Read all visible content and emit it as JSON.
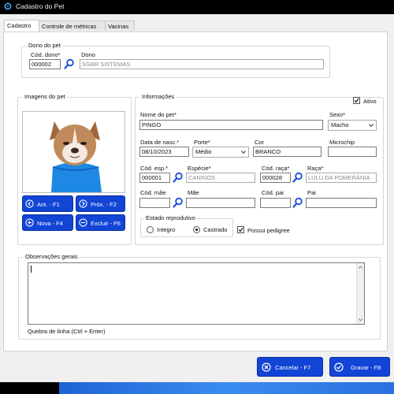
{
  "window": {
    "title": "Cadastro do Pet"
  },
  "tabs": [
    {
      "label": "Cadastro"
    },
    {
      "label": "Controle de métricas"
    },
    {
      "label": "Vacinas"
    }
  ],
  "owner_group": {
    "title": "Dono do pet",
    "code_label": "Cód. dono*",
    "code_value": "000002",
    "name_label": "Dono",
    "name_value": "SGBR SISTEMAS"
  },
  "images_group": {
    "title": "Imagens do pet",
    "buttons": {
      "prev": "Ant. - F1",
      "next": "Próx. - F2",
      "new": "Nova - F4",
      "delete": "Excluir - F6"
    }
  },
  "info_group": {
    "title": "Informações",
    "active_label": "Ativo",
    "active_checked": true,
    "pet_name_label": "Nome do pet*",
    "pet_name_value": "PINGO",
    "sex_label": "Sexo*",
    "sex_value": "Macho",
    "birth_label": "Data de nasc.*",
    "birth_value": "08/10/2023",
    "size_label": "Porte*",
    "size_value": "Médio",
    "color_label": "Cor",
    "color_value": "BRANCO",
    "microchip_label": "Microchip",
    "microchip_value": "",
    "species_code_label": "Cód. esp.*",
    "species_code_value": "000001",
    "species_label": "Espécie*",
    "species_value": "CANINOS",
    "breed_code_label": "Cód. raça*",
    "breed_code_value": "000028",
    "breed_label": "Raça*",
    "breed_value": "LULU DA POMERÂNIA",
    "mother_code_label": "Cód. mãe",
    "mother_code_value": "",
    "mother_label": "Mãe",
    "mother_value": "",
    "father_code_label": "Cód. pai",
    "father_code_value": "",
    "father_label": "Pai",
    "father_value": "",
    "reproductive_label": "Estado reprodutivo",
    "reproductive_options": [
      "Integro",
      "Castrado"
    ],
    "reproductive_selected": "Castrado",
    "pedigree_label": "Possui pedigree",
    "pedigree_checked": true
  },
  "notes_group": {
    "title": "Observações gerais",
    "value": "",
    "hint": "Quebra de linha (Ctrl + Enter)"
  },
  "actions": {
    "cancel": "Cancelar - F7",
    "save": "Gravar - F8"
  },
  "colors": {
    "accent_blue": "#1244d6",
    "magnifier_blue": "#1a4fd8"
  },
  "icons": [
    "app-icon",
    "magnifier-icon",
    "arrow-left-icon",
    "arrow-right-icon",
    "plus-icon",
    "minus-icon",
    "close-icon",
    "check-icon",
    "chevron-down-icon"
  ]
}
